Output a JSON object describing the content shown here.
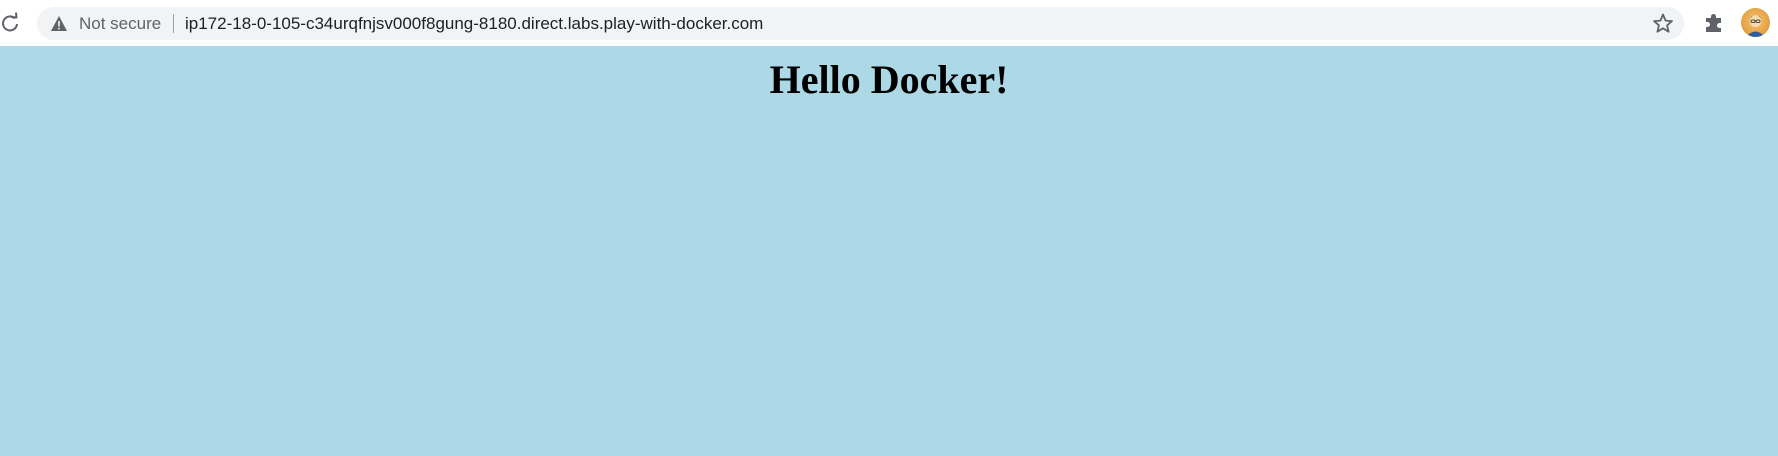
{
  "browser": {
    "security_label": "Not secure",
    "url": "ip172-18-0-105-c34urqfnjsv000f8gung-8180.direct.labs.play-with-docker.com",
    "icons": {
      "reload": "reload-icon",
      "security": "warning-icon",
      "bookmark": "star-icon",
      "extensions": "puzzle-icon",
      "profile": "avatar"
    }
  },
  "page": {
    "heading": "Hello Docker!",
    "background_color": "#add8e6"
  }
}
